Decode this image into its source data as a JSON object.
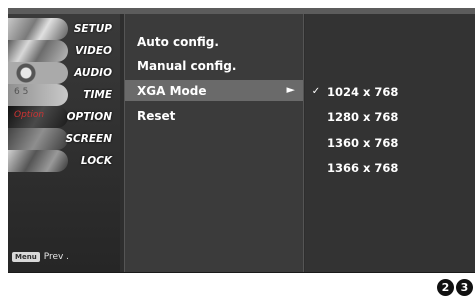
{
  "sidebar": {
    "items": [
      {
        "label": "SETUP"
      },
      {
        "label": "VIDEO"
      },
      {
        "label": "AUDIO"
      },
      {
        "label": "TIME"
      },
      {
        "label": "OPTION"
      },
      {
        "label": "SCREEN"
      },
      {
        "label": "LOCK"
      }
    ],
    "time_thumb_text": "6  5",
    "option_thumb_text": "Option",
    "prev": {
      "key_label": "Menu",
      "label": "Prev ."
    }
  },
  "menu": {
    "items": [
      {
        "label": "Auto config."
      },
      {
        "label": "Manual config."
      },
      {
        "label": "XGA Mode",
        "selected": true,
        "arrow": "►"
      },
      {
        "label": "Reset"
      }
    ]
  },
  "submenu": {
    "items": [
      {
        "check": "✓",
        "label": "1024 x 768"
      },
      {
        "check": "",
        "label": "1280 x 768"
      },
      {
        "check": "",
        "label": "1360 x 768"
      },
      {
        "check": "",
        "label": "1366 x 768"
      }
    ]
  },
  "badges": [
    "2",
    "3"
  ]
}
